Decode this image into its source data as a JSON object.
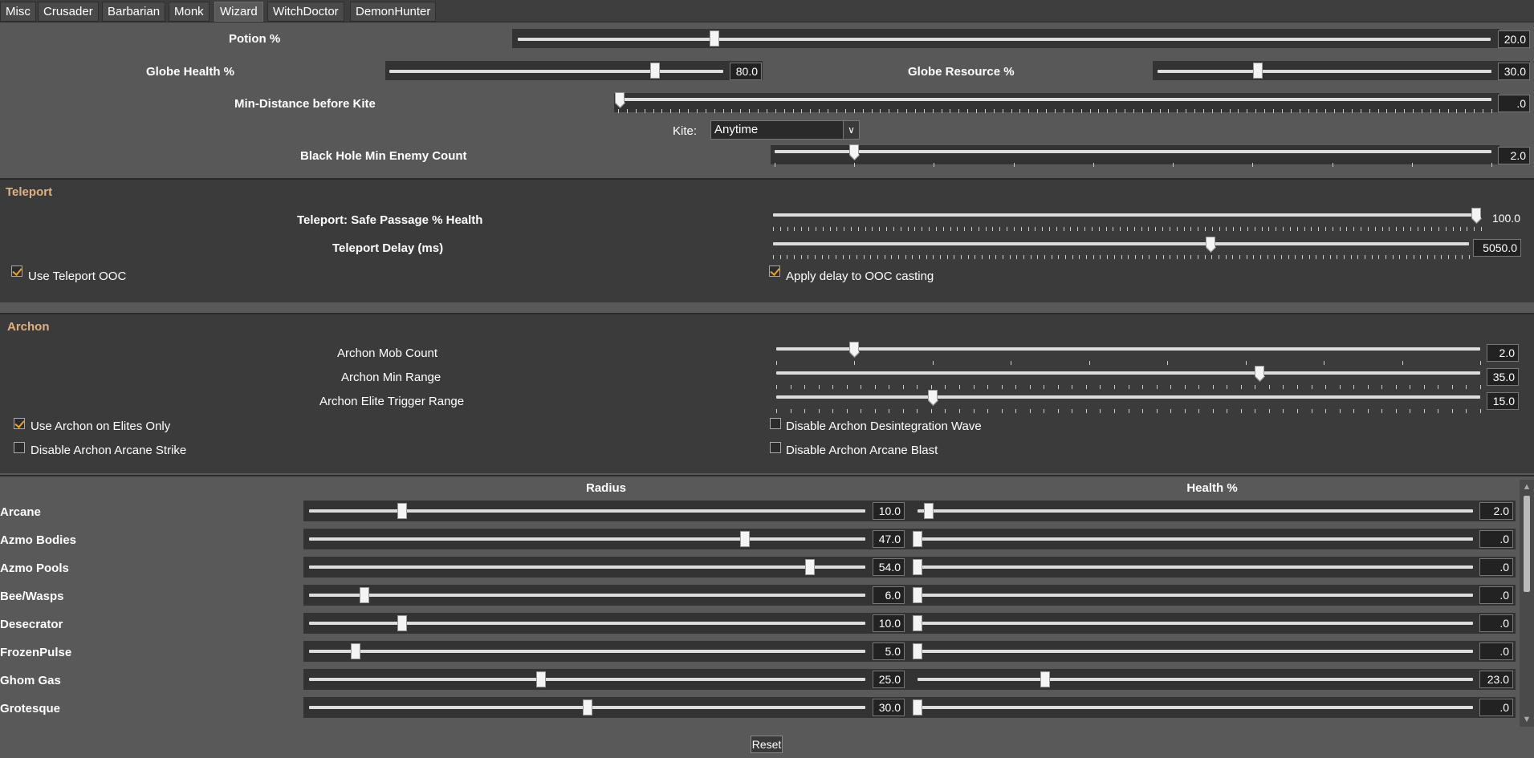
{
  "tabs": [
    "Misc",
    "Crusader",
    "Barbarian",
    "Monk",
    "Wizard",
    "WitchDoctor",
    "DemonHunter"
  ],
  "active_tab": "Wizard",
  "general": {
    "potion_label": "Potion %",
    "potion_value": "20.0",
    "globe_health_label": "Globe Health %",
    "globe_health_value": "80.0",
    "globe_resource_label": "Globe Resource %",
    "globe_resource_value": "30.0",
    "min_distance_label": "Min-Distance before Kite",
    "min_distance_value": ".0",
    "kite_label": "Kite:",
    "kite_value": "Anytime",
    "black_hole_label": "Black Hole Min Enemy Count",
    "black_hole_value": "2.0"
  },
  "teleport": {
    "title": "Teleport",
    "safe_passage_label": "Teleport: Safe Passage % Health",
    "safe_passage_value": "100.0",
    "delay_label": "Teleport Delay (ms)",
    "delay_value": "5050.0",
    "use_ooc_label": "Use Teleport OOC",
    "apply_delay_label": "Apply delay to OOC casting"
  },
  "archon": {
    "title": "Archon",
    "mob_count_label": "Archon Mob Count",
    "mob_count_value": "2.0",
    "min_range_label": "Archon Min Range",
    "min_range_value": "35.0",
    "elite_trigger_label": "Archon Elite Trigger Range",
    "elite_trigger_value": "15.0",
    "elites_only_label": "Use Archon on Elites Only",
    "disable_wave_label": "Disable Archon Desintegration Wave",
    "disable_strike_label": "Disable Archon Arcane Strike",
    "disable_blast_label": "Disable Archon Arcane Blast"
  },
  "avoidance": {
    "radius_header": "Radius",
    "health_header": "Health %",
    "rows": [
      {
        "name": "Arcane",
        "radius": "10.0",
        "health": "2.0"
      },
      {
        "name": "Azmo Bodies",
        "radius": "47.0",
        "health": ".0"
      },
      {
        "name": "Azmo Pools",
        "radius": "54.0",
        "health": ".0"
      },
      {
        "name": "Bee/Wasps",
        "radius": "6.0",
        "health": ".0"
      },
      {
        "name": "Desecrator",
        "radius": "10.0",
        "health": ".0"
      },
      {
        "name": "FrozenPulse",
        "radius": "5.0",
        "health": ".0"
      },
      {
        "name": "Ghom Gas",
        "radius": "25.0",
        "health": "23.0"
      },
      {
        "name": "Grotesque",
        "radius": "30.0",
        "health": ".0"
      }
    ]
  },
  "reset_label": "Reset"
}
